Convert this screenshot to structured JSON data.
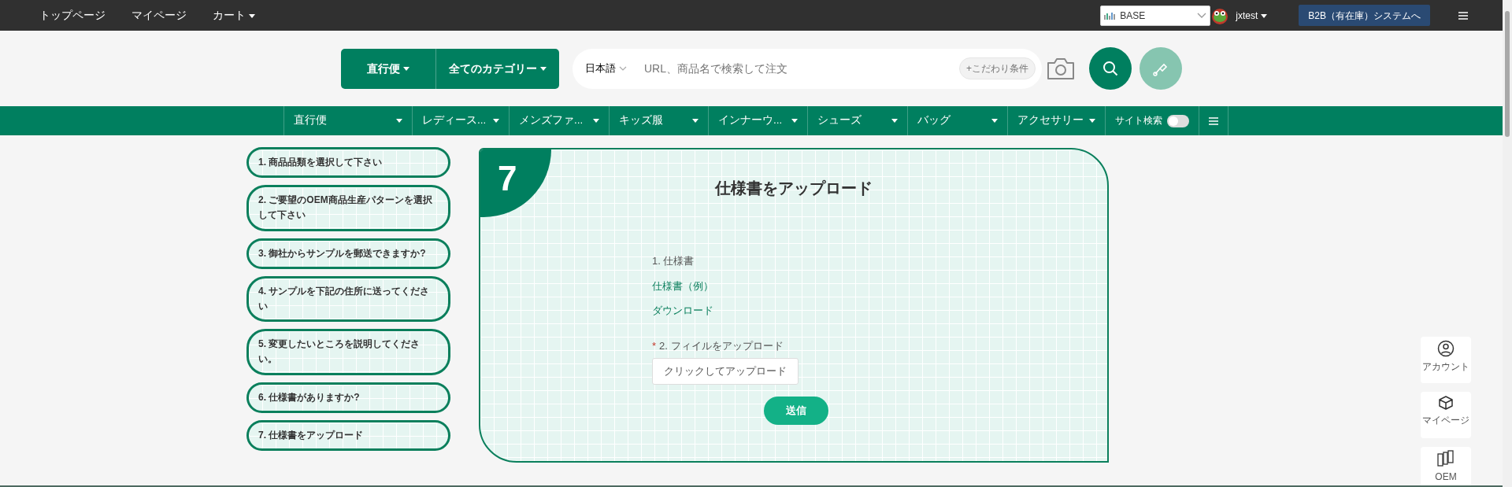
{
  "top_nav": {
    "links": [
      {
        "label": "トップページ",
        "dropdown": false
      },
      {
        "label": "マイページ",
        "dropdown": false
      },
      {
        "label": "カート",
        "dropdown": true
      }
    ],
    "store_select": {
      "value": "BASE"
    },
    "user": {
      "name": "jxtest"
    },
    "b2b_button": "B2B（有在庫）システムへ"
  },
  "search": {
    "mode_button": "直行便",
    "category_button": "全てのカテゴリー",
    "language": "日本語",
    "placeholder": "URL、商品名で検索して注文",
    "filter_chip": "+こだわり条件"
  },
  "category_nav": {
    "items": [
      {
        "label": "直行便"
      },
      {
        "label": "レディース..."
      },
      {
        "label": "メンズファ..."
      },
      {
        "label": "キッズ服"
      },
      {
        "label": "インナーウ..."
      },
      {
        "label": "シューズ"
      },
      {
        "label": "バッグ"
      },
      {
        "label": "アクセサリー"
      }
    ],
    "site_search": {
      "label": "サイト検索",
      "on": false
    }
  },
  "steps": [
    {
      "label": "1. 商品品類を選択して下さい"
    },
    {
      "label": "2. ご要望のOEM商品生産パターンを選択して下さい"
    },
    {
      "label": "3. 御社からサンプルを郵送できますか?"
    },
    {
      "label": "4. サンプルを下記の住所に送ってください"
    },
    {
      "label": "5. 変更したいところを説明してください。"
    },
    {
      "label": "6. 仕様書がありますか?"
    },
    {
      "label": "7. 仕様書をアップロード"
    }
  ],
  "card": {
    "step_number": "7",
    "title": "仕様書をアップロード",
    "spec_label": "1. 仕様書",
    "spec_example": "仕様書（例）",
    "download_link": "ダウンロード",
    "upload_label": "2. フィイルをアップロード",
    "required_mark": "*",
    "upload_button": "クリックしてアップロード",
    "submit_button": "送信"
  },
  "side_widgets": [
    {
      "kind": "account",
      "label": "アカウント"
    },
    {
      "kind": "mypage",
      "label": "マイページ"
    },
    {
      "kind": "oem",
      "label": "OEM"
    }
  ]
}
